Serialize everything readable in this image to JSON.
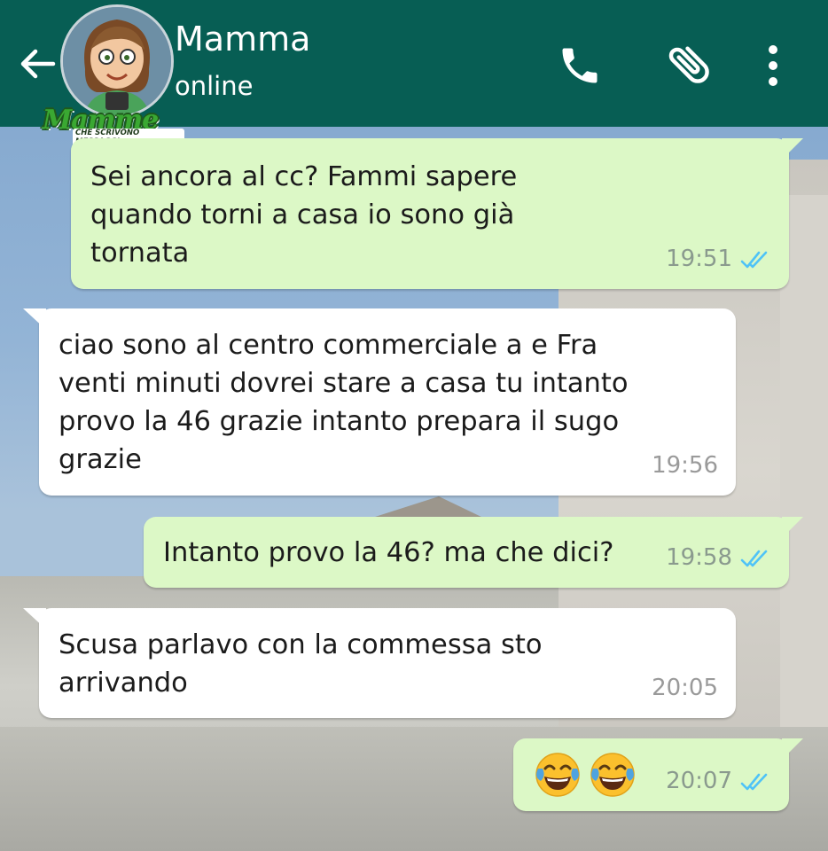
{
  "header": {
    "contact_name": "Mamma",
    "status": "online",
    "logo_title": "Mamme",
    "logo_subtitle": "CHE SCRIVONO MESSAGGI",
    "colors": {
      "bar": "#075e54",
      "text": "#ffffff"
    },
    "icons": [
      "back-arrow-icon",
      "phone-icon",
      "paperclip-icon",
      "more-vert-icon"
    ]
  },
  "messages": [
    {
      "direction": "outgoing",
      "text": "Sei ancora al cc? Fammi sapere quando torni a casa io sono già tornata",
      "time": "19:51",
      "read": true
    },
    {
      "direction": "incoming",
      "text": "ciao sono al centro commerciale a e Fra venti minuti dovrei stare a casa tu intanto provo la 46 grazie intanto prepara il sugo grazie",
      "time": "19:56"
    },
    {
      "direction": "outgoing",
      "text": "Intanto provo la 46? ma che dici?",
      "time": "19:58",
      "read": true
    },
    {
      "direction": "incoming",
      "text": "Scusa parlavo con la commessa sto arrivando",
      "time": "20:05"
    },
    {
      "direction": "outgoing",
      "text": "",
      "emoji": [
        "face-with-tears-of-joy",
        "face-with-tears-of-joy"
      ],
      "time": "20:07",
      "read": true
    }
  ],
  "colors": {
    "outgoing_bubble": "#dcf8c6",
    "incoming_bubble": "#ffffff",
    "read_ticks": "#4fc3f7"
  }
}
